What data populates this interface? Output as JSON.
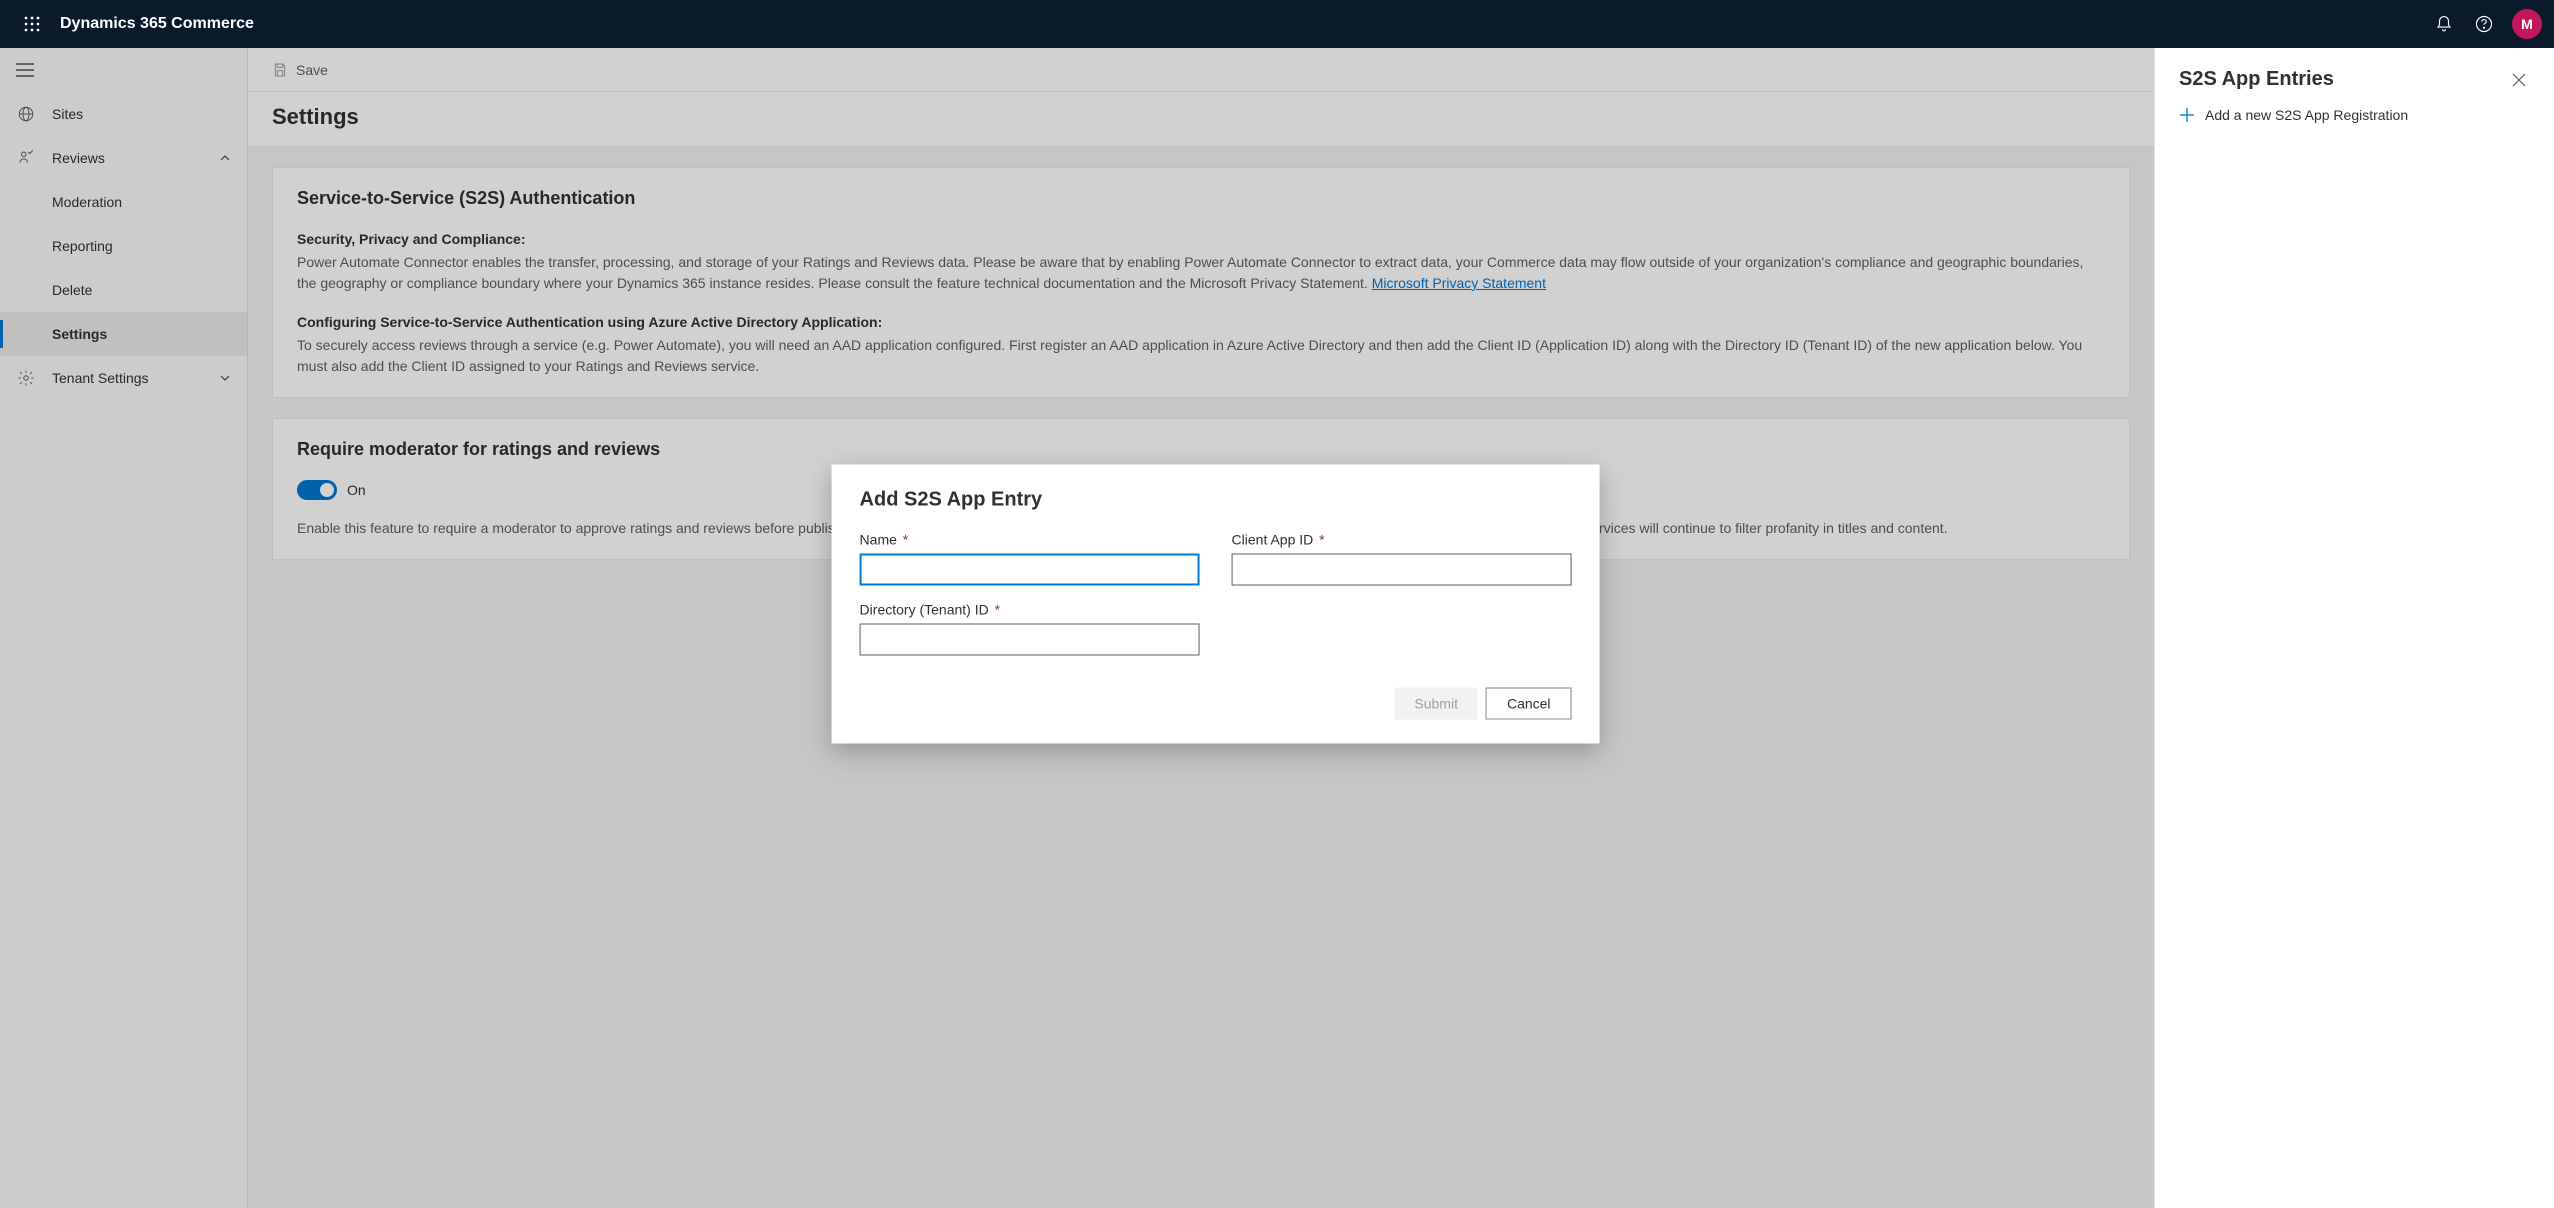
{
  "topbar": {
    "product": "Dynamics 365 Commerce",
    "avatar_initial": "M"
  },
  "sidebar": {
    "items": [
      {
        "label": "Sites"
      },
      {
        "label": "Reviews"
      },
      {
        "label": "Moderation"
      },
      {
        "label": "Reporting"
      },
      {
        "label": "Delete"
      },
      {
        "label": "Settings"
      },
      {
        "label": "Tenant Settings"
      }
    ]
  },
  "cmdbar": {
    "save": "Save"
  },
  "page": {
    "title": "Settings"
  },
  "s2s_card": {
    "heading": "Service-to-Service (S2S) Authentication",
    "compliance_label": "Security, Privacy and Compliance:",
    "compliance_text": "Power Automate Connector enables the transfer, processing, and storage of your Ratings and Reviews data. Please be aware that by enabling Power Automate Connector to extract data, your Commerce data may flow outside of your organization's compliance and geographic boundaries, the geography or compliance boundary where your Dynamics 365 instance resides. Please consult the feature technical documentation and the Microsoft Privacy Statement.",
    "compliance_link": "Microsoft Privacy Statement",
    "config_label": "Configuring Service-to-Service Authentication using Azure Active Directory Application:",
    "config_text": "To securely access reviews through a service (e.g. Power Automate), you will need an AAD application configured. First register an AAD application in Azure Active Directory and then add the Client ID (Application ID) along with the Directory ID (Tenant ID) of the new application below. You must also add the Client ID assigned to your Ratings and Reviews service."
  },
  "moderator_card": {
    "heading": "Require moderator for ratings and reviews",
    "toggle_label": "On",
    "desc": "Enable this feature to require a moderator to approve ratings and reviews before publishing. Enabling this feature will queue customer-submitted reviews to require approval before publishing. Azure Cognitive Services will continue to filter profanity in titles and content."
  },
  "rightpanel": {
    "title": "S2S App Entries",
    "add_label": "Add a new S2S App Registration"
  },
  "modal": {
    "title": "Add S2S App Entry",
    "name_label": "Name",
    "client_label": "Client App ID",
    "tenant_label": "Directory (Tenant) ID",
    "name_value": "",
    "client_value": "",
    "tenant_value": "",
    "submit": "Submit",
    "cancel": "Cancel"
  }
}
